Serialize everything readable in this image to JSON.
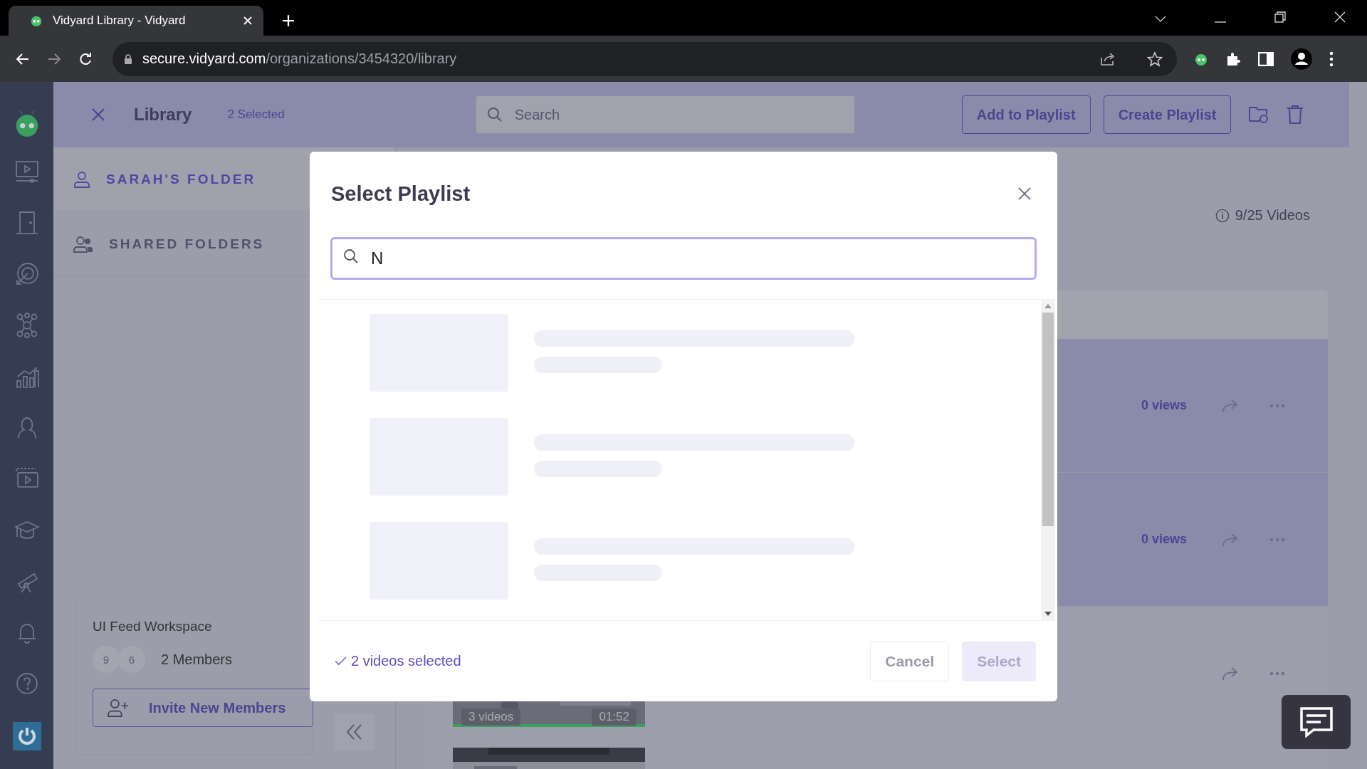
{
  "browser": {
    "tab": {
      "title": "Vidyard Library - Vidyard"
    },
    "url": {
      "host": "secure.vidyard.com",
      "path": "/organizations/3454320/library"
    }
  },
  "header": {
    "title": "Library",
    "selected_count": "2 Selected",
    "search": {
      "placeholder": "Search"
    },
    "buttons": [
      "Add to Playlist",
      "Create Playlist"
    ]
  },
  "sidebar": {
    "folders": [
      {
        "label": "SARAH'S FOLDER",
        "kind": "personal",
        "selected": true
      },
      {
        "label": "SHARED FOLDERS",
        "kind": "shared",
        "selected": false
      }
    ],
    "workspace": {
      "name": "UI Feed Workspace",
      "avatars": [
        "9",
        "6"
      ],
      "members": "2 Members",
      "invite_button": "Invite New Members"
    }
  },
  "library": {
    "video_count": "9/25 Videos",
    "rows": [
      {
        "views": "0 views",
        "selected": true
      },
      {
        "views": "0 views",
        "selected": true
      },
      {
        "selected": false,
        "badges": {
          "playlist": "3 videos",
          "duration": "01:52"
        }
      }
    ]
  },
  "modal": {
    "title": "Select Playlist",
    "search": {
      "value": "N"
    },
    "skeleton_rows": [
      {
        "kind": "skeleton"
      },
      {
        "kind": "skeleton"
      },
      {
        "kind": "skeleton"
      }
    ],
    "selection_note": "2 videos selected",
    "buttons": [
      {
        "label": "Cancel",
        "kind": "secondary",
        "disabled": false
      },
      {
        "label": "Select",
        "kind": "primary",
        "disabled": true
      }
    ]
  }
}
